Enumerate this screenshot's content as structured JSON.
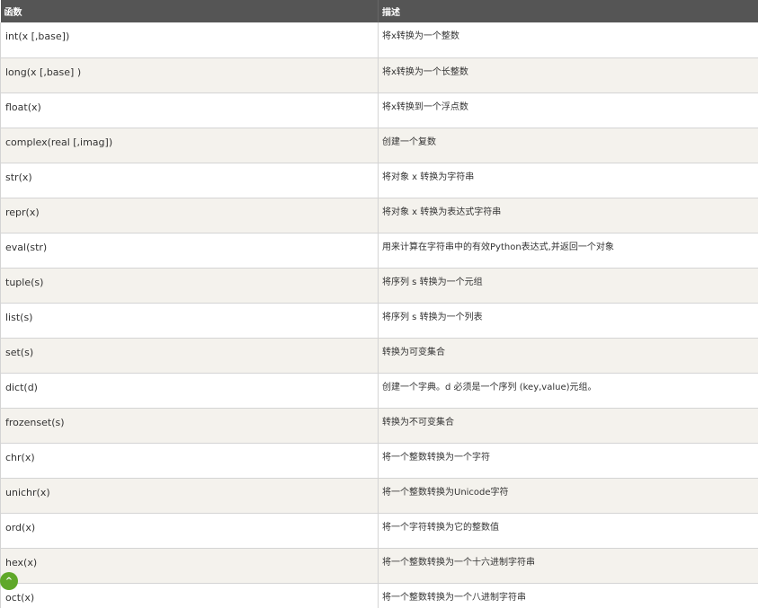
{
  "header": {
    "col_function": "函数",
    "col_description": "描述"
  },
  "rows": [
    {
      "fn": "int(x [,base])",
      "desc": "将x转换为一个整数"
    },
    {
      "fn": "long(x [,base] )",
      "desc": "将x转换为一个长整数"
    },
    {
      "fn": "float(x)",
      "desc": "将x转换到一个浮点数"
    },
    {
      "fn": "complex(real [,imag])",
      "desc": "创建一个复数"
    },
    {
      "fn": "str(x)",
      "desc": "将对象 x 转换为字符串"
    },
    {
      "fn": "repr(x)",
      "desc": "将对象 x 转换为表达式字符串"
    },
    {
      "fn": "eval(str)",
      "desc": "用来计算在字符串中的有效Python表达式,并返回一个对象"
    },
    {
      "fn": "tuple(s)",
      "desc": "将序列 s 转换为一个元组"
    },
    {
      "fn": "list(s)",
      "desc": "将序列 s 转换为一个列表"
    },
    {
      "fn": "set(s)",
      "desc": "转换为可变集合"
    },
    {
      "fn": "dict(d)",
      "desc": "创建一个字典。d 必须是一个序列 (key,value)元组。"
    },
    {
      "fn": "frozenset(s)",
      "desc": "转换为不可变集合"
    },
    {
      "fn": "chr(x)",
      "desc": "将一个整数转换为一个字符"
    },
    {
      "fn": "unichr(x)",
      "desc": "将一个整数转换为Unicode字符"
    },
    {
      "fn": "ord(x)",
      "desc": "将一个字符转换为它的整数值"
    },
    {
      "fn": "hex(x)",
      "desc": "将一个整数转换为一个十六进制字符串"
    },
    {
      "fn": "oct(x)",
      "desc": "将一个整数转换为一个八进制字符串"
    }
  ],
  "back_to_top": {
    "icon": "chevron-up-icon",
    "glyph": "^",
    "color": "#5fa829"
  }
}
